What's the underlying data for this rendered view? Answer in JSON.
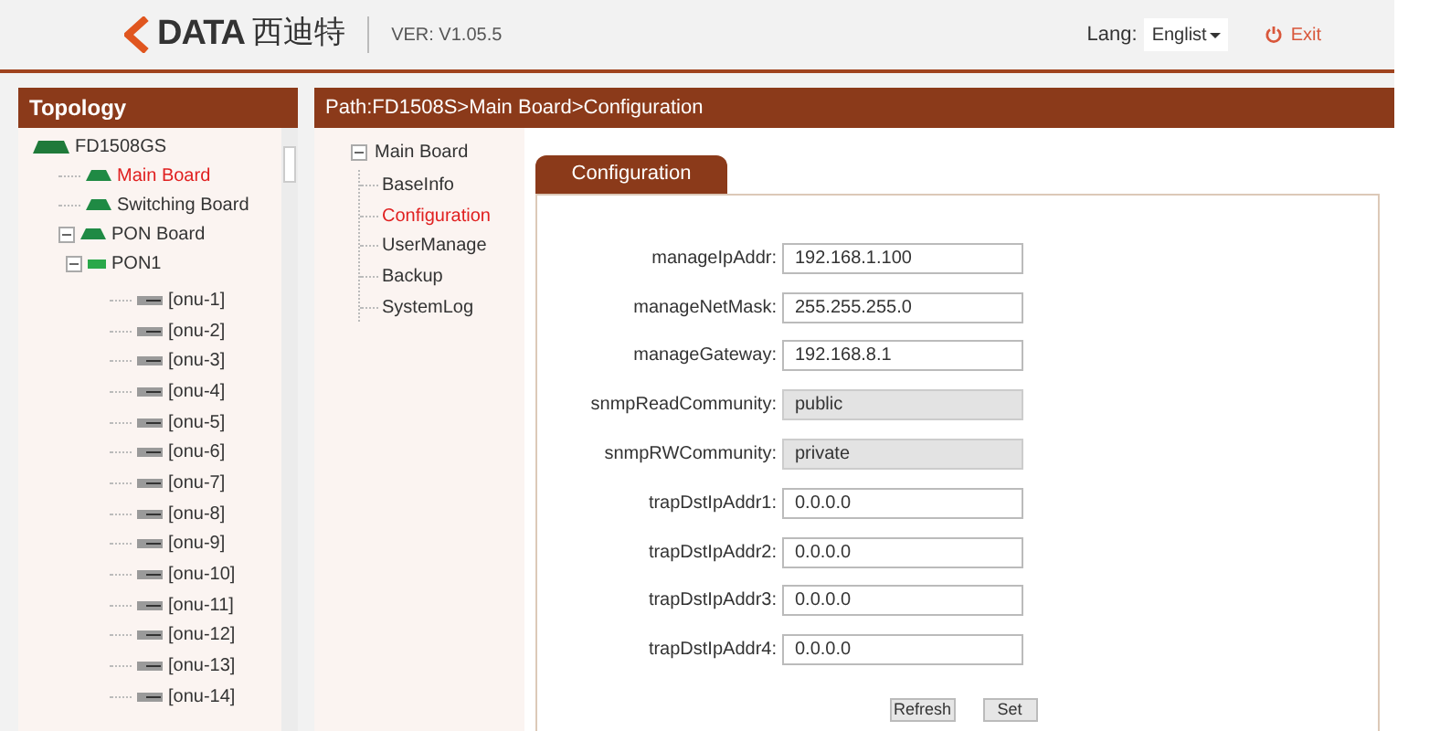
{
  "header": {
    "logo_text": "DATA",
    "logo_cn": "西迪特",
    "version": "VER: V1.05.5",
    "lang_label": "Lang:",
    "lang_value": "Englist",
    "exit": "Exit"
  },
  "topology": {
    "title": "Topology",
    "tree": [
      {
        "label": "FD1508GS",
        "kind": "chassis",
        "selected": false,
        "children": [
          {
            "label": "Main Board",
            "kind": "board",
            "selected": true
          },
          {
            "label": "Switching Board",
            "kind": "board",
            "selected": false
          },
          {
            "label": "PON Board",
            "kind": "board",
            "selected": false,
            "expanded": true,
            "children": [
              {
                "label": "PON1",
                "kind": "pon",
                "selected": false,
                "expanded": true,
                "children": [
                  {
                    "label": "[onu-1]",
                    "kind": "onu",
                    "selected": false
                  },
                  {
                    "label": "[onu-2]",
                    "kind": "onu",
                    "selected": false
                  },
                  {
                    "label": "[onu-3]",
                    "kind": "onu",
                    "selected": false
                  },
                  {
                    "label": "[onu-4]",
                    "kind": "onu",
                    "selected": false
                  },
                  {
                    "label": "[onu-5]",
                    "kind": "onu",
                    "selected": false
                  },
                  {
                    "label": "[onu-6]",
                    "kind": "onu",
                    "selected": false
                  },
                  {
                    "label": "[onu-7]",
                    "kind": "onu",
                    "selected": false
                  },
                  {
                    "label": "[onu-8]",
                    "kind": "onu",
                    "selected": false
                  },
                  {
                    "label": "[onu-9]",
                    "kind": "onu",
                    "selected": false
                  },
                  {
                    "label": "[onu-10]",
                    "kind": "onu",
                    "selected": false
                  },
                  {
                    "label": "[onu-11]",
                    "kind": "onu",
                    "selected": false
                  },
                  {
                    "label": "[onu-12]",
                    "kind": "onu",
                    "selected": false
                  },
                  {
                    "label": "[onu-13]",
                    "kind": "onu",
                    "selected": false
                  },
                  {
                    "label": "[onu-14]",
                    "kind": "onu",
                    "selected": false
                  }
                ]
              }
            ]
          }
        ]
      }
    ]
  },
  "path": "Path:FD1508S>Main Board>Configuration",
  "nav": {
    "label": "Main Board",
    "expanded": true,
    "items": [
      {
        "label": "BaseInfo",
        "selected": false
      },
      {
        "label": "Configuration",
        "selected": true
      },
      {
        "label": "UserManage",
        "selected": false
      },
      {
        "label": "Backup",
        "selected": false
      },
      {
        "label": "SystemLog",
        "selected": false
      }
    ]
  },
  "tab": {
    "label": "Configuration",
    "selected": true
  },
  "fields": [
    {
      "label": "manageIpAddr:",
      "value": "192.168.1.100",
      "disabled": false
    },
    {
      "label": "manageNetMask:",
      "value": "255.255.255.0",
      "disabled": false
    },
    {
      "label": "manageGateway:",
      "value": "192.168.8.1",
      "disabled": false
    },
    {
      "label": "snmpReadCommunity:",
      "value": "public",
      "disabled": true
    },
    {
      "label": "snmpRWCommunity:",
      "value": "private",
      "disabled": true
    },
    {
      "label": "trapDstIpAddr1:",
      "value": "0.0.0.0",
      "disabled": false
    },
    {
      "label": "trapDstIpAddr2:",
      "value": "0.0.0.0",
      "disabled": false
    },
    {
      "label": "trapDstIpAddr3:",
      "value": "0.0.0.0",
      "disabled": false
    },
    {
      "label": "trapDstIpAddr4:",
      "value": "0.0.0.0",
      "disabled": false
    }
  ],
  "buttons": [
    "Refresh",
    "Set"
  ]
}
